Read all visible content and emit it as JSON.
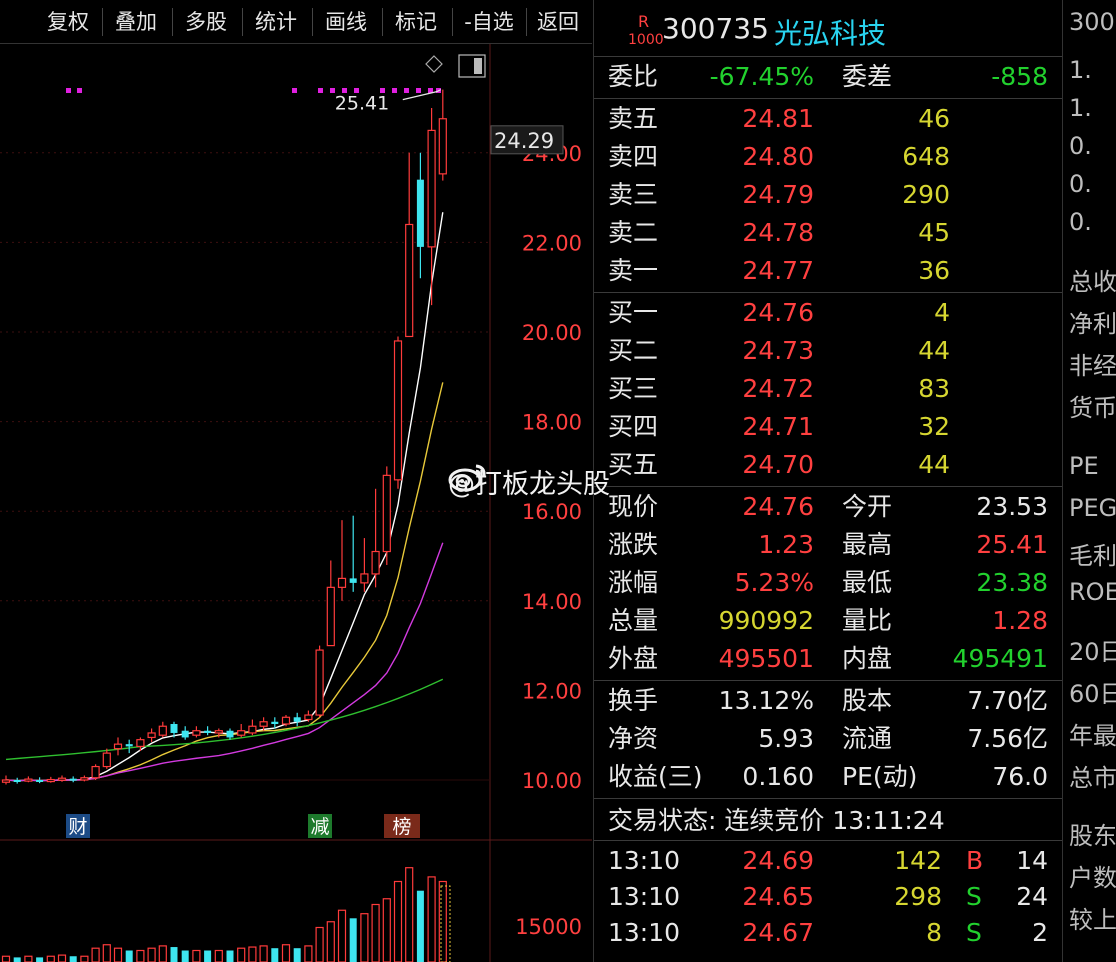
{
  "toolbar": {
    "buttons": [
      "复权",
      "叠加",
      "多股",
      "统计",
      "画线",
      "标记",
      "-自选",
      "返回"
    ]
  },
  "chart": {
    "max_label": "25.41",
    "current_price_tag": "24.29",
    "y_ticks": [
      "24.00",
      "22.00",
      "20.00",
      "18.00",
      "16.00",
      "14.00",
      "12.00",
      "10.00"
    ],
    "volume_tick": "15000",
    "event_markers": [
      "财",
      "减",
      "榜"
    ],
    "colors": {
      "up": "#ff3b3b",
      "down": "#3ee6f0",
      "ma5": "#ffffff",
      "ma10": "#e8c93a",
      "ma20": "#d23adf",
      "ma60": "#2fbf2f",
      "signal": "#e020e0"
    }
  },
  "quote": {
    "header": {
      "badge_top": "R",
      "badge_bottom": "1000",
      "code": "300735",
      "name": "光弘科技"
    },
    "weibi": {
      "label": "委比",
      "value": "-67.45%",
      "diff_label": "委差",
      "diff_value": "-858"
    },
    "sell": [
      {
        "label": "卖五",
        "price": "24.81",
        "vol": "46"
      },
      {
        "label": "卖四",
        "price": "24.80",
        "vol": "648"
      },
      {
        "label": "卖三",
        "price": "24.79",
        "vol": "290"
      },
      {
        "label": "卖二",
        "price": "24.78",
        "vol": "45"
      },
      {
        "label": "卖一",
        "price": "24.77",
        "vol": "36"
      }
    ],
    "buy": [
      {
        "label": "买一",
        "price": "24.76",
        "vol": "4"
      },
      {
        "label": "买二",
        "price": "24.73",
        "vol": "44"
      },
      {
        "label": "买三",
        "price": "24.72",
        "vol": "83"
      },
      {
        "label": "买四",
        "price": "24.71",
        "vol": "32"
      },
      {
        "label": "买五",
        "price": "24.70",
        "vol": "44"
      }
    ],
    "stats": [
      {
        "l1": "现价",
        "v1": "24.76",
        "l2": "今开",
        "v2": "23.53"
      },
      {
        "l1": "涨跌",
        "v1": "1.23",
        "l2": "最高",
        "v2": "25.41"
      },
      {
        "l1": "涨幅",
        "v1": "5.23%",
        "l2": "最低",
        "v2": "23.38"
      },
      {
        "l1": "总量",
        "v1": "990992",
        "l2": "量比",
        "v2": "1.28"
      },
      {
        "l1": "外盘",
        "v1": "495501",
        "l2": "内盘",
        "v2": "495491"
      }
    ],
    "fund": [
      {
        "l1": "换手",
        "v1": "13.12%",
        "l2": "股本",
        "v2": "7.70亿"
      },
      {
        "l1": "净资",
        "v1": "5.93",
        "l2": "流通",
        "v2": "7.56亿"
      },
      {
        "l1": "收益(三)",
        "v1": "0.160",
        "l2": "PE(动)",
        "v2": "76.0"
      }
    ],
    "status": "交易状态: 连续竞价 13:11:24",
    "ticks": [
      {
        "time": "13:10",
        "price": "24.69",
        "vol": "142",
        "side": "B",
        "count": "14"
      },
      {
        "time": "13:10",
        "price": "24.65",
        "vol": "298",
        "side": "S",
        "count": "24"
      },
      {
        "time": "13:10",
        "price": "24.67",
        "vol": "8",
        "side": "S",
        "count": "2"
      }
    ]
  },
  "right_panel": {
    "lines": [
      "300",
      "1.",
      "1.",
      "0.",
      "0.",
      "0.",
      "总收",
      "净利",
      "非经",
      "货币",
      "PE",
      "PEG",
      "毛利",
      "ROE",
      "20日",
      "60日",
      "年最",
      "总市",
      "股东",
      "户数",
      "较上"
    ]
  },
  "watermark": "@打板龙头股"
}
